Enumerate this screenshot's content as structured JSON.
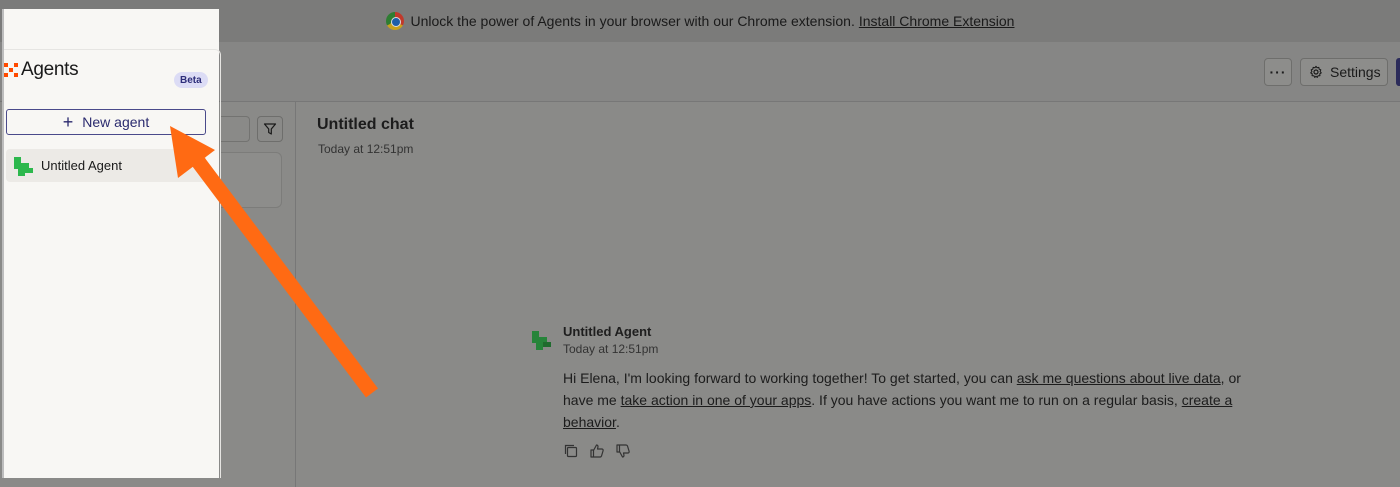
{
  "banner": {
    "text": "Unlock the power of Agents in your browser with our Chrome extension.",
    "link": "Install Chrome Extension",
    "icon": "chrome-icon"
  },
  "toolbar": {
    "more_label": "···",
    "settings_label": "Settings"
  },
  "sidebar": {
    "brand": "Agents",
    "badge": "Beta",
    "new_agent_label": "New agent",
    "agents": [
      {
        "label": "Untitled Agent"
      }
    ]
  },
  "chat": {
    "title": "Untitled chat",
    "timestamp": "Today at 12:51pm",
    "message": {
      "author": "Untitled Agent",
      "timestamp": "Today at 12:51pm",
      "text_1": "Hi Elena, I'm looking forward to working together! To get started, you can ",
      "link_1": "ask me questions about live data",
      "text_2": ", or have me ",
      "link_2": "take action in one of your apps",
      "text_3": ". If you have actions you want me to run on a regular basis, ",
      "link_3": "create a behavior",
      "text_4": "."
    }
  },
  "colors": {
    "accent": "#2a2a6e",
    "annotation_arrow": "#ff6a13",
    "agent_logo": "#2db84d"
  }
}
